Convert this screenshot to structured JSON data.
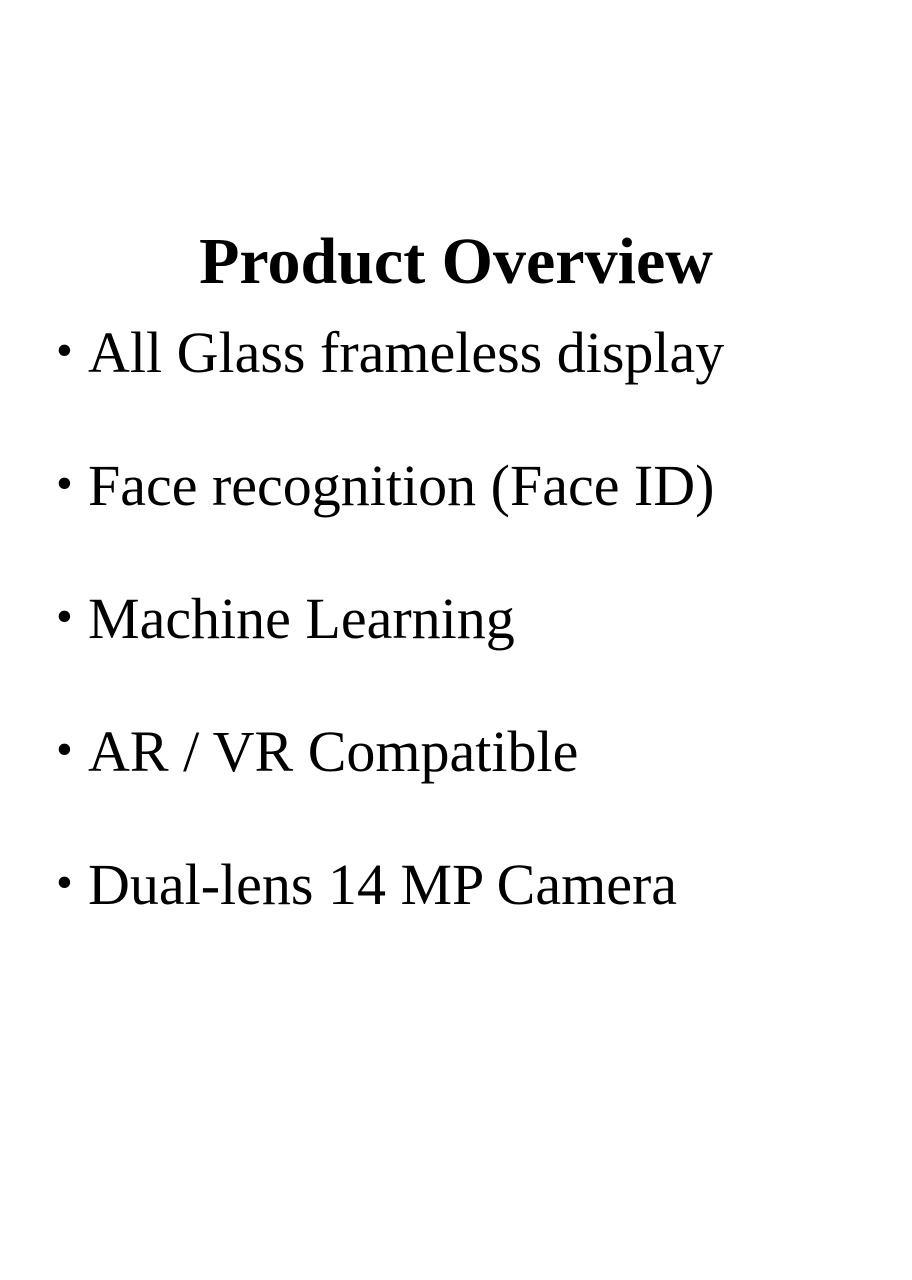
{
  "title": "Product Overview",
  "bullet_glyph": "•",
  "features": [
    "All Glass frameless display",
    "Face recognition (Face ID)",
    "Machine Learning",
    "AR / VR Compatible",
    "Dual-lens 14 MP Camera"
  ]
}
